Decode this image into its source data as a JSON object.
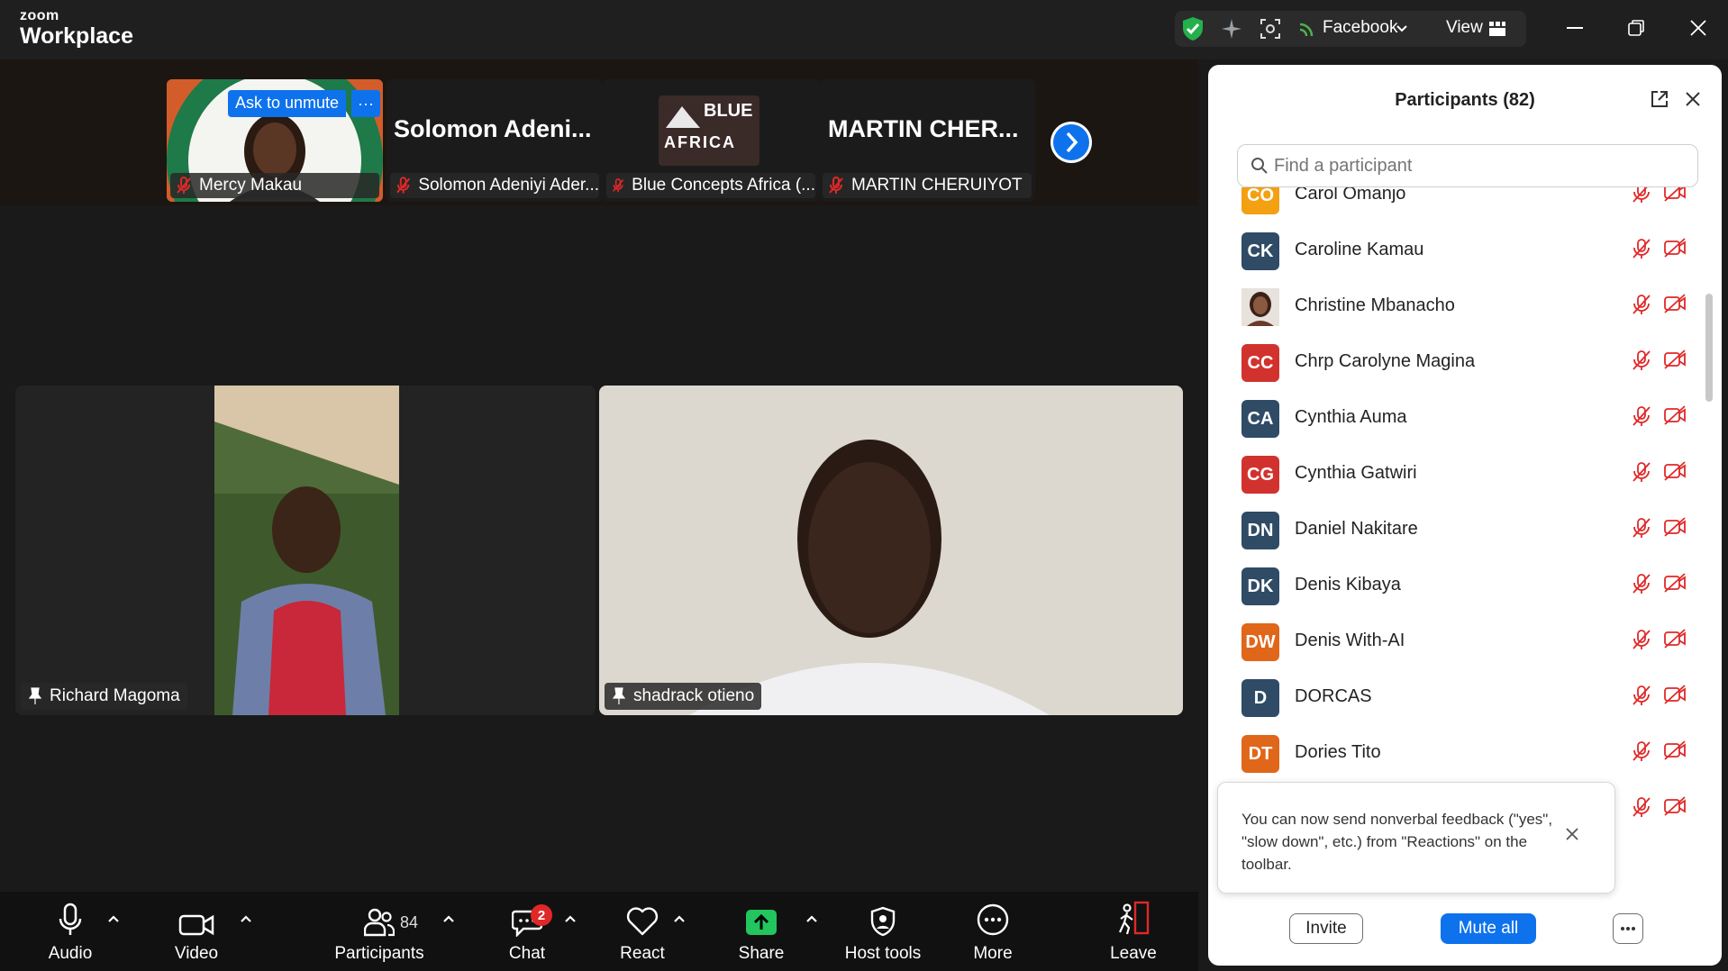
{
  "titlebar": {
    "brand_small": "zoom",
    "brand_big": "Workplace",
    "live_app": "Facebook",
    "view_label": "View"
  },
  "filmstrip": {
    "ask_to_unmute": "Ask to unmute",
    "tiles": [
      {
        "name": "Mercy Makau",
        "big": ""
      },
      {
        "name": "Solomon Adeniyi Ader...",
        "big": "Solomon  Adeni..."
      },
      {
        "name": "Blue Concepts Africa (...",
        "big": "",
        "logo_line1": "BLUE",
        "logo_line2": "AFRICA"
      },
      {
        "name": "MARTIN CHERUIYOT",
        "big": "MARTIN  CHER..."
      }
    ]
  },
  "videos": [
    {
      "name": "Richard Magoma"
    },
    {
      "name": "shadrack otieno"
    }
  ],
  "toolbar": {
    "audio": "Audio",
    "video": "Video",
    "participants": "Participants",
    "participants_count": "84",
    "chat": "Chat",
    "chat_badge": "2",
    "react": "React",
    "share": "Share",
    "host_tools": "Host tools",
    "more": "More",
    "leave": "Leave"
  },
  "panel": {
    "title": "Participants (82)",
    "search_placeholder": "Find a participant",
    "participants": [
      {
        "initials": "CO",
        "name": "Carol Omanjo",
        "color": "#f3a012"
      },
      {
        "initials": "CK",
        "name": "Caroline Kamau",
        "color": "#2f4b66"
      },
      {
        "initials": "",
        "name": "Christine Mbanacho",
        "color": "#8a6a55",
        "photo": true
      },
      {
        "initials": "CC",
        "name": "Chrp  Carolyne Magina",
        "color": "#d2322d"
      },
      {
        "initials": "CA",
        "name": "Cynthia Auma",
        "color": "#2f4b66"
      },
      {
        "initials": "CG",
        "name": "Cynthia Gatwiri",
        "color": "#d2322d"
      },
      {
        "initials": "DN",
        "name": "Daniel Nakitare",
        "color": "#2f4b66"
      },
      {
        "initials": "DK",
        "name": "Denis Kibaya",
        "color": "#2f4b66"
      },
      {
        "initials": "DW",
        "name": "Denis With-AI",
        "color": "#e0661a"
      },
      {
        "initials": "D",
        "name": "DORCAS",
        "color": "#2f4b66"
      },
      {
        "initials": "DT",
        "name": "Dories Tito",
        "color": "#e0661a"
      }
    ],
    "tooltip": "You can now send nonverbal feedback (\"yes\", \"slow down\", etc.) from \"Reactions\" on the toolbar.",
    "invite": "Invite",
    "mute_all": "Mute all"
  }
}
